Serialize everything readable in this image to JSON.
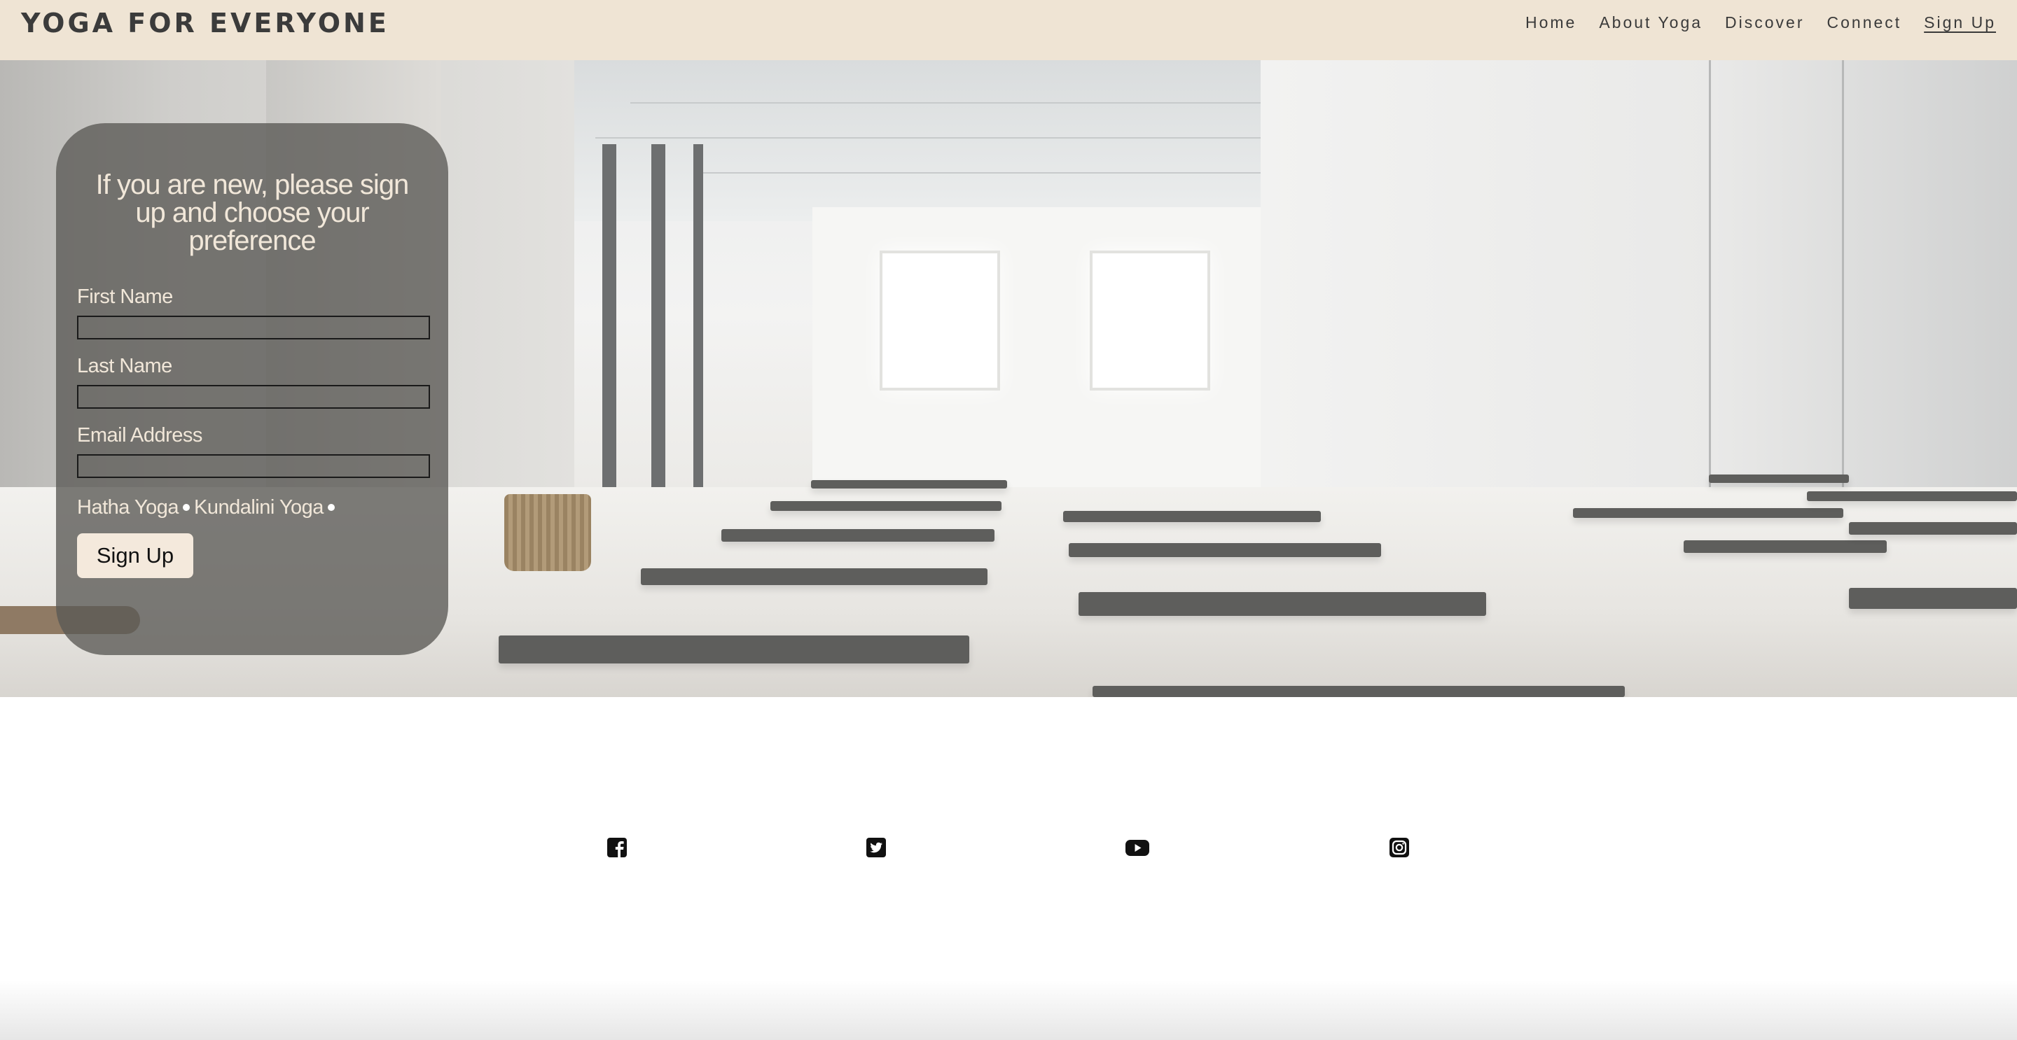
{
  "header": {
    "brand": "YOGA FOR EVERYONE",
    "nav": [
      "Home",
      "About Yoga",
      "Discover",
      "Connect",
      "Sign Up"
    ],
    "active_item": "Sign Up",
    "background_color": "#efe4d4"
  },
  "signup_form": {
    "title": "If you are new, please sign up and choose your preference",
    "first_name_label": "First Name",
    "last_name_label": "Last Name",
    "email_label": "Email Address",
    "first_name_value": "",
    "last_name_value": "",
    "email_value": "",
    "options": [
      "Hatha Yoga",
      "Kundalini Yoga"
    ],
    "submit_label": "Sign Up"
  },
  "social": {
    "icons": [
      "facebook-icon",
      "twitter-icon",
      "youtube-icon",
      "instagram-icon"
    ]
  }
}
